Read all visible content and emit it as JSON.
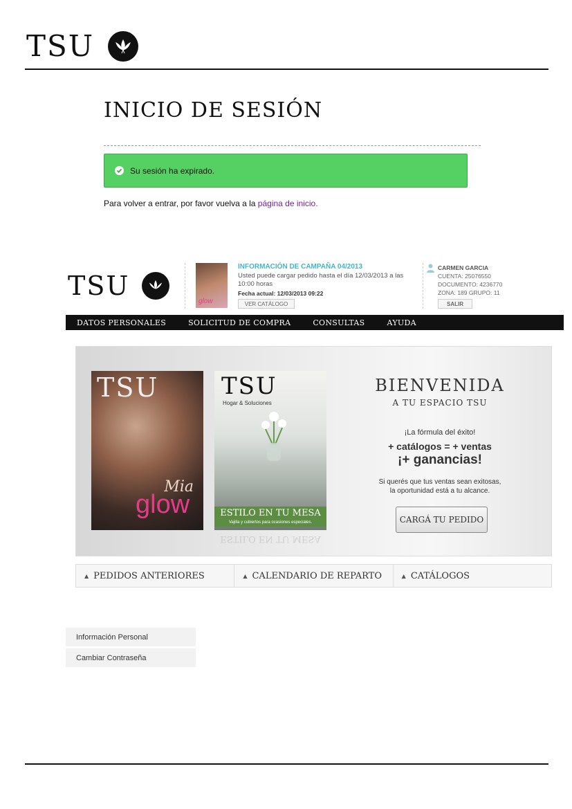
{
  "brand": {
    "logo_text": "TSU"
  },
  "page": {
    "title": "INICIO DE SESIÓN",
    "alert": "Su sesión ha expirado.",
    "message_prefix": "Para volver a entrar, por favor vuelva a la",
    "message_link": "página de inicio",
    "message_suffix": "."
  },
  "screenshot": {
    "campaign": {
      "title": "INFORMACIÓN DE CAMPAÑA 04/2013",
      "text": "Usted puede cargar pedido hasta el día 12/03/2013 a las 10:00 horas",
      "date_label": "Fecha actual: 12/03/2013 09:22",
      "catalog_button": "VER CATÁLOGO",
      "cover_text": "glow"
    },
    "user": {
      "name": "CARMEN GARCIA",
      "account": "CUENTA: 25076550",
      "document": "DOCUMENTO: 4236770",
      "zone": "ZONA: 189   GRUPO: 11",
      "logout": "SALIR"
    },
    "nav": [
      "DATOS PERSONALES",
      "SOLICITUD DE COMPRA",
      "CONSULTAS",
      "AYUDA"
    ],
    "banner": {
      "cover1_script": "Mia",
      "cover1_title": "glow",
      "cover2_sub": "Hogar & Soluciones",
      "cover2_title": "ESTILO EN TU MESA",
      "cover2_caption": "Vajilla y cubiertos para ocasiones especiales.",
      "cover2_reflection": "ESTILO EN TU MESA",
      "heading": "BIENVENIDA",
      "subheading": "A TU ESPACIO TSU",
      "line1": "¡La fórmula del éxito!",
      "line2": "+ catálogos = + ventas",
      "line3": "¡+ ganancias!",
      "line4": "Si querés que tus ventas sean exitosas,",
      "line5": "la oportunidad está a tu alcance.",
      "cta": "CARGÁ TU PEDIDO"
    },
    "tabs": [
      "PEDIDOS ANTERIORES",
      "CALENDARIO DE REPARTO",
      "CATÁLOGOS"
    ],
    "sidebar": [
      "Información Personal",
      "Cambiar Contraseña"
    ]
  },
  "colors": {
    "alert_green": "#55d063",
    "link_purple": "#7a1fa2",
    "campaign_teal": "#3fb7c9"
  }
}
